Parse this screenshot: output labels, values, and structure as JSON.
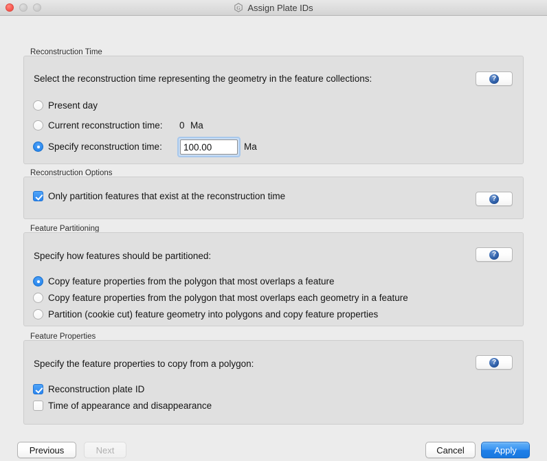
{
  "window": {
    "title": "Assign Plate IDs",
    "app_icon": "gplates-hexagon-icon",
    "traffic_lights": [
      {
        "name": "close-button",
        "color": "#fa5e56"
      },
      {
        "name": "minimize-button",
        "color": "#cfcfcf"
      },
      {
        "name": "zoom-button",
        "color": "#cfcfcf"
      }
    ]
  },
  "help_label": "?",
  "groups": {
    "reconstruction_time": {
      "title": "Reconstruction Time",
      "prompt": "Select the reconstruction time representing the geometry in the feature collections:",
      "options": [
        {
          "label": "Present day",
          "checked": false
        },
        {
          "label": "Current reconstruction time:",
          "checked": false,
          "value": "0",
          "unit": "Ma"
        },
        {
          "label": "Specify reconstruction time:",
          "checked": true,
          "value": "100.00",
          "unit": "Ma"
        }
      ]
    },
    "reconstruction_options": {
      "title": "Reconstruction Options",
      "checkboxes": [
        {
          "label": "Only partition features that exist at the reconstruction time",
          "checked": true
        }
      ]
    },
    "feature_partitioning": {
      "title": "Feature Partitioning",
      "prompt": "Specify how features should be partitioned:",
      "options": [
        {
          "label": "Copy feature properties from the polygon that most overlaps a feature",
          "checked": true
        },
        {
          "label": "Copy feature properties from the polygon that most overlaps each geometry in a feature",
          "checked": false
        },
        {
          "label": "Partition (cookie cut) feature geometry into polygons and copy feature properties",
          "checked": false
        }
      ]
    },
    "feature_properties": {
      "title": "Feature Properties",
      "prompt": "Specify the feature properties to copy from a polygon:",
      "checkboxes": [
        {
          "label": "Reconstruction plate ID",
          "checked": true
        },
        {
          "label": "Time of appearance and disappearance",
          "checked": false
        }
      ]
    }
  },
  "footer": {
    "previous_label": "Previous",
    "next_label": "Next",
    "next_disabled": true,
    "cancel_label": "Cancel",
    "apply_label": "Apply",
    "accent_color": "#1f7fe8"
  }
}
